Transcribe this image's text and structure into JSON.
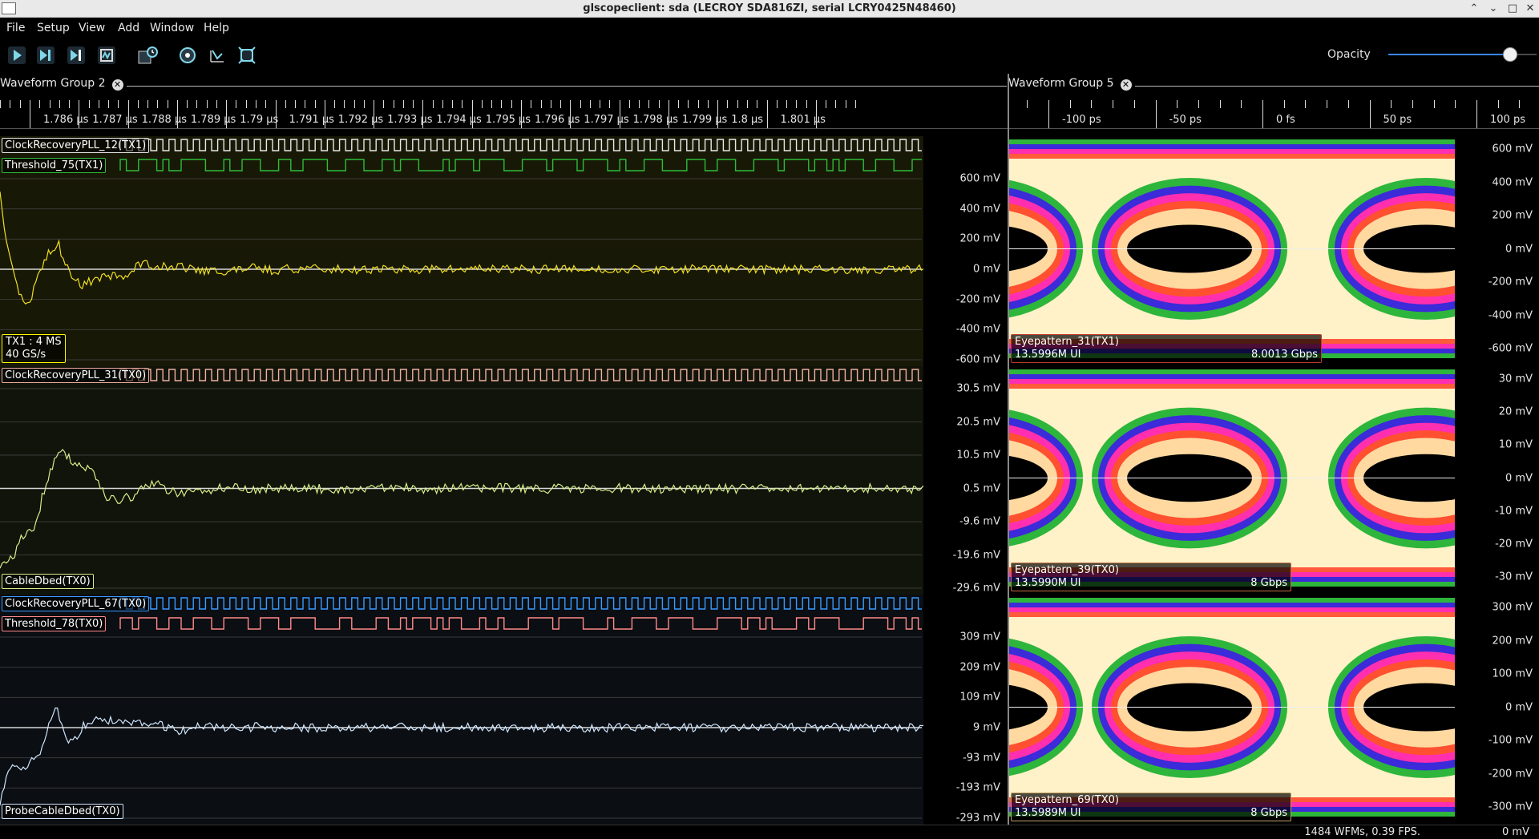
{
  "window": {
    "title": "glscopeclient: sda (LECROY SDA816ZI, serial LCRY0425N48460)",
    "minimize": "⌃",
    "restore": "⌄",
    "maximize": "□",
    "close": "✕"
  },
  "menu": [
    "File",
    "Setup",
    "View",
    "Add",
    "Window",
    "Help"
  ],
  "toolbar": {
    "buttons": [
      "start-trigger-icon",
      "single-trigger-icon",
      "force-trigger-icon",
      "stop-trigger-icon",
      "history-icon",
      "refresh-icon",
      "fullscreen-icon",
      "zoom-fit-icon"
    ],
    "opacity_label": "Opacity",
    "opacity_value": 0.82
  },
  "groups": {
    "left": {
      "title": "Waveform Group 2",
      "close": "✕"
    },
    "right": {
      "title": "Waveform Group 5",
      "close": "✕"
    }
  },
  "left_ruler": [
    "1.786 µs",
    "1.787 µs",
    "1.788 µs",
    "1.789 µs",
    "1.79 µs",
    "1.791 µs",
    "1.792 µs",
    "1.793 µs",
    "1.794 µs",
    "1.795 µs",
    "1.796 µs",
    "1.797 µs",
    "1.798 µs",
    "1.799 µs",
    "1.8 µs",
    "1.801 µs"
  ],
  "right_ruler": [
    "-100 ps",
    "-50 ps",
    "0 fs",
    "50 ps",
    "100 ps"
  ],
  "panes": [
    {
      "digital": [
        {
          "label": "ClockRecoveryPLL_12(TX1)",
          "color": "#e8e8e8"
        },
        {
          "label": "Threshold_75(TX1)",
          "color": "#2dbd3a"
        }
      ],
      "analog_label": "",
      "analog_color": "#f0e020",
      "info": {
        "line1": "TX1 : 4 MS",
        "line2": "40 GS/s"
      },
      "y_labels": [
        "600 mV",
        "400 mV",
        "200 mV",
        "0 mV",
        "-200 mV",
        "-400 mV",
        "-600 mV"
      ],
      "eye": {
        "name": "Eyepattern_31(TX1)",
        "ui": "13.5996M UI",
        "rate": "8.0013 Gbps",
        "border": "#c0392b"
      },
      "eye_y_labels": [
        "600 mV",
        "400 mV",
        "200 mV",
        "0 mV",
        "-200 mV",
        "-400 mV",
        "-600 mV"
      ]
    },
    {
      "digital": [
        {
          "label": "ClockRecoveryPLL_31(TX0)",
          "color": "#f0b0a0"
        }
      ],
      "analog_label": "CableDbed(TX0)",
      "analog_color": "#d6ef8a",
      "info": null,
      "y_labels": [
        "30.5 mV",
        "20.5 mV",
        "10.5 mV",
        "0.5 mV",
        "-9.6 mV",
        "-19.6 mV",
        "-29.6 mV"
      ],
      "eye": {
        "name": "Eyepattern_39(TX0)",
        "ui": "13.5990M UI",
        "rate": "8 Gbps",
        "border": "#c07040"
      },
      "eye_y_labels": [
        "30 mV",
        "20 mV",
        "10 mV",
        "0 mV",
        "-10 mV",
        "-20 mV",
        "-30 mV"
      ]
    },
    {
      "digital": [
        {
          "label": "ClockRecoveryPLL_67(TX0)",
          "color": "#3a9bff"
        },
        {
          "label": "Threshold_78(TX0)",
          "color": "#ff8a8a"
        }
      ],
      "analog_label": "ProbeCableDbed(TX0)",
      "analog_color": "#cfe6ff",
      "info": null,
      "y_labels": [
        "309 mV",
        "209 mV",
        "109 mV",
        "9 mV",
        "-93 mV",
        "-193 mV",
        "-293 mV"
      ],
      "eye": {
        "name": "Eyepattern_69(TX0)",
        "ui": "13.5989M UI",
        "rate": "8 Gbps",
        "border": "#c0a060"
      },
      "eye_y_labels": [
        "300 mV",
        "200 mV",
        "100 mV",
        "0 mV",
        "-100 mV",
        "-200 mV",
        "-300 mV"
      ]
    }
  ],
  "status": {
    "text": "1484 WFMs, 0.39 FPS.",
    "cursor": "0 mV"
  }
}
